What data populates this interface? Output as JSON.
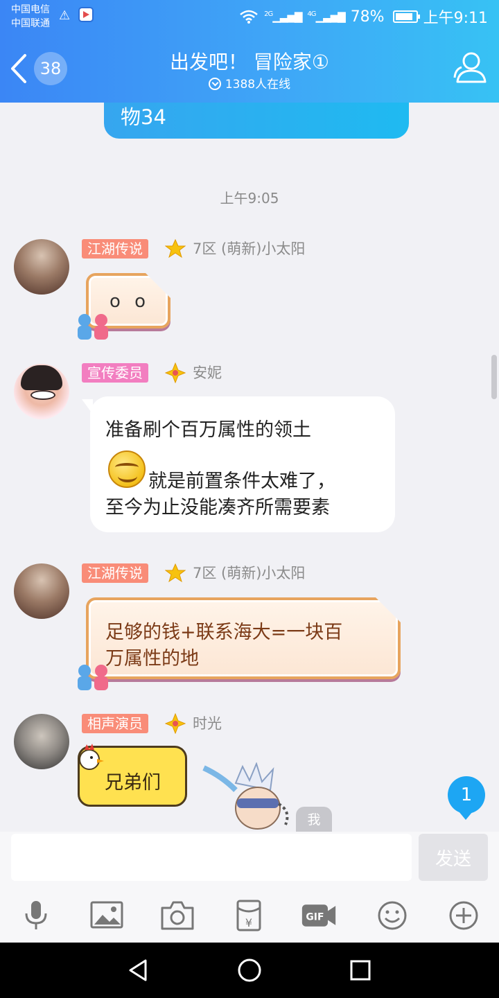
{
  "status_bar": {
    "carrier_1": "中国电信",
    "carrier_2": "中国联通",
    "net_2g": "2G",
    "net_4g": "4G",
    "battery": "78%",
    "time": "上午9:11"
  },
  "header": {
    "back_count": "38",
    "title": "出发吧！ 冒险家①",
    "online": "1388人在线"
  },
  "chat": {
    "prev_message_tail": "物34",
    "timestamp": "上午9:05",
    "messages": [
      {
        "tag": "江湖传说",
        "tag_color": "#f98c78",
        "nickname": "7区 (萌新)小太阳",
        "text": "o o"
      },
      {
        "tag": "宣传委员",
        "tag_color": "#f27ec0",
        "nickname": "安妮",
        "line1": "准备刷个百万属性的领土",
        "line2": "就是前置条件太难了，",
        "line3": "至今为止没能凑齐所需要素"
      },
      {
        "tag": "江湖传说",
        "tag_color": "#f98c78",
        "nickname": "7区 (萌新)小太阳",
        "line1": "足够的钱+联系海大=一块百",
        "line2": "万属性的地"
      },
      {
        "tag": "相声演员",
        "tag_color": "#f98c78",
        "nickname": "时光",
        "text": "兄弟们"
      }
    ],
    "me_label": "我",
    "unread_count": "1"
  },
  "composer": {
    "input_value": "",
    "send_label": "发送"
  },
  "toolbar": [
    "mic-icon",
    "image-icon",
    "camera-icon",
    "red-packet-icon",
    "gif-icon",
    "emoji-icon",
    "plus-icon"
  ],
  "theme": {
    "accent": "#3fa6f7",
    "bubble_blue": "#1fbaf1"
  }
}
